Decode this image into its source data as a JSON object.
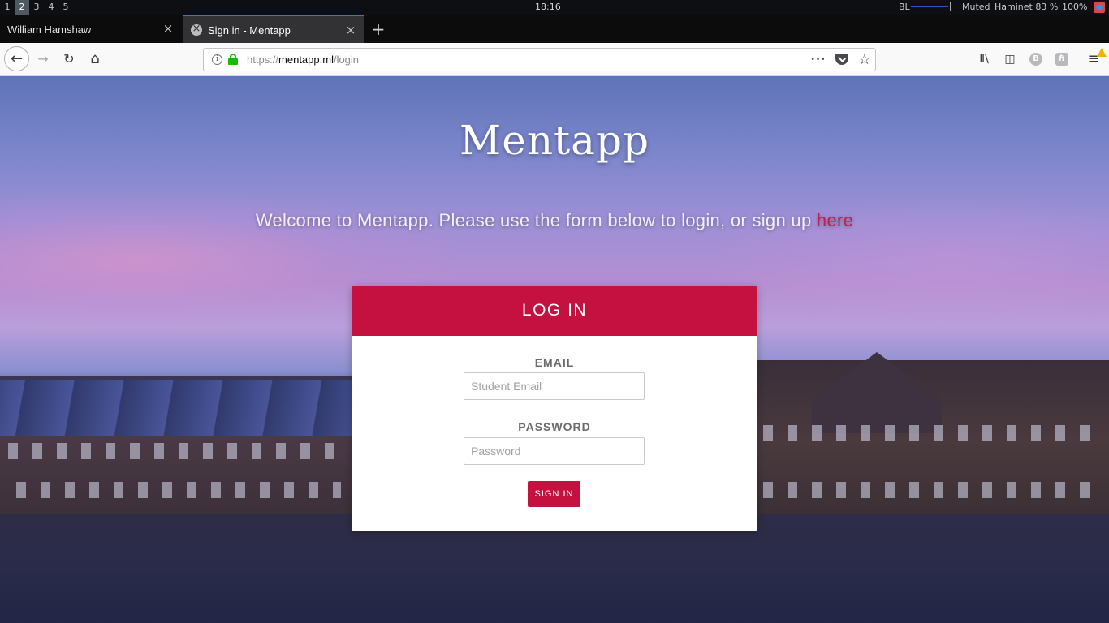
{
  "topbar": {
    "workspaces": [
      "1",
      "2",
      "3",
      "4",
      "5"
    ],
    "active_workspace": "2",
    "clock": "18:16",
    "backlight_label": "BL",
    "volume": "Muted",
    "wifi": "Haminet 83 %",
    "battery": "100%"
  },
  "tabs": [
    {
      "title": "William Hamshaw",
      "close": "×",
      "active": false
    },
    {
      "title": "Sign in - Mentapp",
      "close": "×",
      "active": true
    }
  ],
  "newtab_label": "+",
  "nav": {
    "back": "←",
    "forward": "→",
    "reload": "↻",
    "home": "⌂",
    "url_scheme": "https://",
    "url_host": "mentapp.ml",
    "url_path": "/login",
    "page_actions": "•••",
    "bookmark_star": "☆",
    "library_icon": "Ⅱ\\",
    "sidebar_icon": "◫",
    "ext1": "B",
    "ext2": "ℏ",
    "menu_icon": "≡"
  },
  "page": {
    "title": "Mentapp",
    "subtitle": "Welcome to Mentapp. Please use the form below to login, or sign up ",
    "signup_link": "here",
    "card": {
      "heading": "LOG IN",
      "email_label": "EMAIL",
      "email_placeholder": "Student Email",
      "password_label": "PASSWORD",
      "password_placeholder": "Password",
      "submit": "SIGN IN"
    }
  },
  "colors": {
    "brand": "#c4113f",
    "accent_tab": "#0a84ff",
    "lock_green": "#12bc00"
  }
}
